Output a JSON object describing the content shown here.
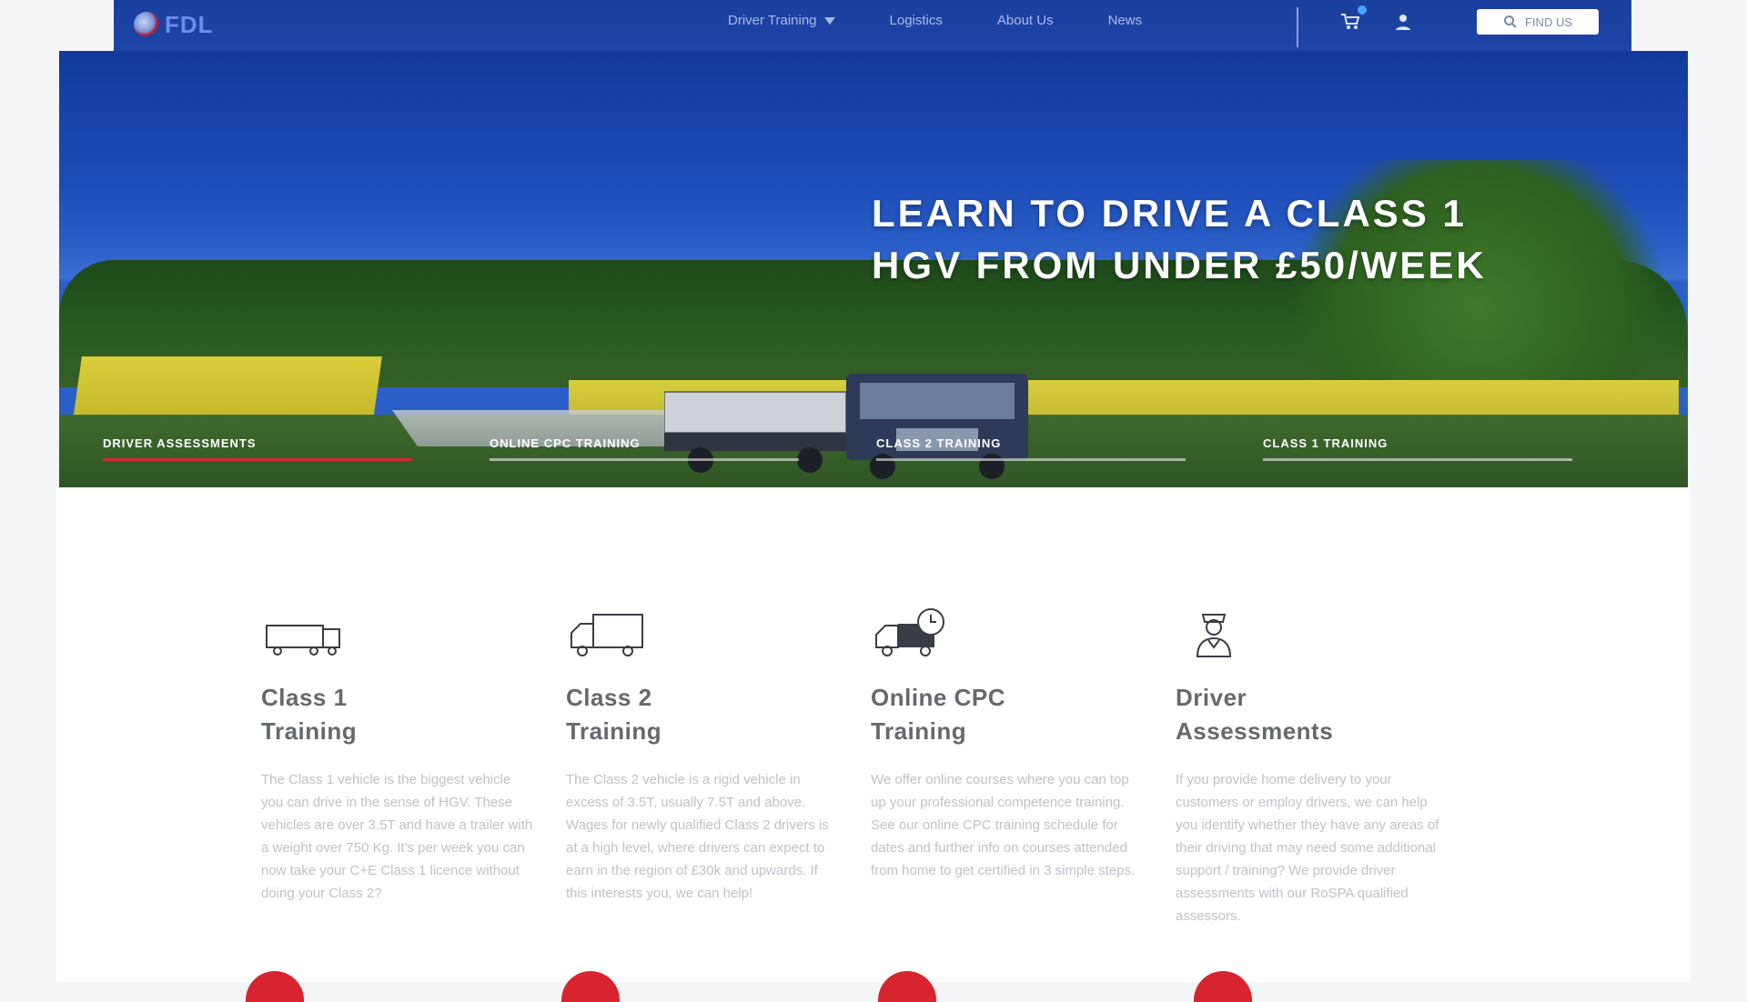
{
  "header": {
    "logo_text": "FDL",
    "nav": [
      {
        "label": "Driver Training",
        "has_dropdown": true
      },
      {
        "label": "Logistics",
        "has_dropdown": false
      },
      {
        "label": "About Us",
        "has_dropdown": false
      },
      {
        "label": "News",
        "has_dropdown": false
      }
    ],
    "search_label": "FIND US",
    "icons": [
      "cart-icon",
      "user-icon",
      "search-icon"
    ]
  },
  "hero": {
    "headline": "LEARN TO DRIVE A CLASS 1 HGV FROM UNDER £50/WEEK",
    "tabs": [
      {
        "label": "DRIVER ASSESSMENTS",
        "active": true
      },
      {
        "label": "ONLINE CPC TRAINING",
        "active": false
      },
      {
        "label": "CLASS 2 TRAINING",
        "active": false
      },
      {
        "label": "CLASS 1 TRAINING",
        "active": false
      }
    ]
  },
  "cards": [
    {
      "icon": "articulated-truck-icon",
      "title_line1": "Class 1",
      "title_line2": "Training",
      "text": "The Class 1 vehicle is the biggest vehicle you can drive in the sense of HGV. These vehicles are over 3.5T and have a trailer with a weight over 750 Kg. It's per week you can now take your C+E Class 1 licence without doing your Class 2?"
    },
    {
      "icon": "rigid-truck-icon",
      "title_line1": "Class 2",
      "title_line2": "Training",
      "text": "The Class 2 vehicle is a rigid vehicle in excess of 3.5T, usually 7.5T and above. Wages for newly qualified Class 2 drivers is at a high level, where drivers can expect to earn in the region of £30k and upwards. If this interests you, we can help!"
    },
    {
      "icon": "truck-clock-icon",
      "title_line1": "Online CPC",
      "title_line2": "Training",
      "text": "We offer online courses where you can top up your professional competence training. See our online CPC training schedule for dates and further info on courses attended from home to get certified in 3 simple steps."
    },
    {
      "icon": "driver-assessor-icon",
      "title_line1": "Driver",
      "title_line2": "Assessments",
      "text": "If you provide home delivery to your customers or employ drivers, we can help you identify whether they have any areas of their driving that may need some additional support / training? We provide driver assessments with our RoSPA qualified assessors."
    }
  ],
  "colors": {
    "header_blue": "#1d45a8",
    "accent_red": "#d6283a",
    "headline_white": "#ffffff"
  }
}
